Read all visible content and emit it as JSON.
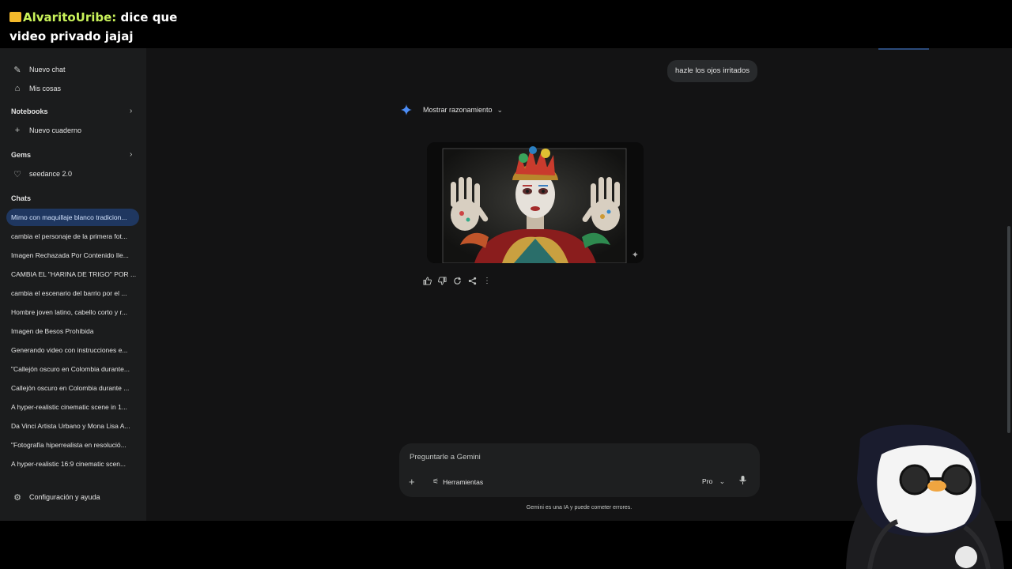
{
  "overlay": {
    "username": "AlvaritoUribe:",
    "message": "dice que video privado jajaj"
  },
  "sidebar": {
    "top_items": [
      {
        "label": "Nuevo chat",
        "icon": "edit-icon"
      },
      {
        "label": "Mis cosas",
        "icon": "mystuff-icon"
      }
    ],
    "notebooks": {
      "title": "Notebooks",
      "new_label": "Nuevo cuaderno"
    },
    "gems": {
      "title": "Gems",
      "items": [
        {
          "label": "seedance 2.0"
        }
      ]
    },
    "chats": {
      "title": "Chats",
      "items": [
        {
          "label": "Mimo con maquillaje blanco tradicion..."
        },
        {
          "label": "cambia el personaje de la primera fot..."
        },
        {
          "label": "Imagen Rechazada Por Contenido Ile..."
        },
        {
          "label": "CAMBIA EL \"HARINA DE TRIGO\" POR ..."
        },
        {
          "label": "cambia el escenario del barrio por el ..."
        },
        {
          "label": "Hombre joven latino, cabello corto y r..."
        },
        {
          "label": "Imagen de Besos Prohibida"
        },
        {
          "label": "Generando video con instrucciones e..."
        },
        {
          "label": "\"Callejón oscuro en Colombia durante..."
        },
        {
          "label": "Callejón oscuro en Colombia durante ..."
        },
        {
          "label": "A hyper-realistic cinematic scene in 1..."
        },
        {
          "label": "Da Vinci Artista Urbano y Mona Lisa A..."
        },
        {
          "label": "\"Fotografía hiperrealista en resolució..."
        },
        {
          "label": "A hyper-realistic 16:9 cinematic scen..."
        }
      ]
    },
    "settings_label": "Configuración y ayuda"
  },
  "conversation": {
    "user_message": "hazle los ojos irritados",
    "reasoning_label": "Mostrar razonamiento"
  },
  "composer": {
    "placeholder": "Preguntarle a Gemini",
    "tools_label": "Herramientas",
    "model_label": "Pro",
    "disclaimer": "Gemini es una IA y puede cometer errores."
  },
  "colors": {
    "background": "#131314",
    "sidebar": "#1b1c1d",
    "active_chat": "#1f3760",
    "accent_star": "#4c8df6"
  }
}
